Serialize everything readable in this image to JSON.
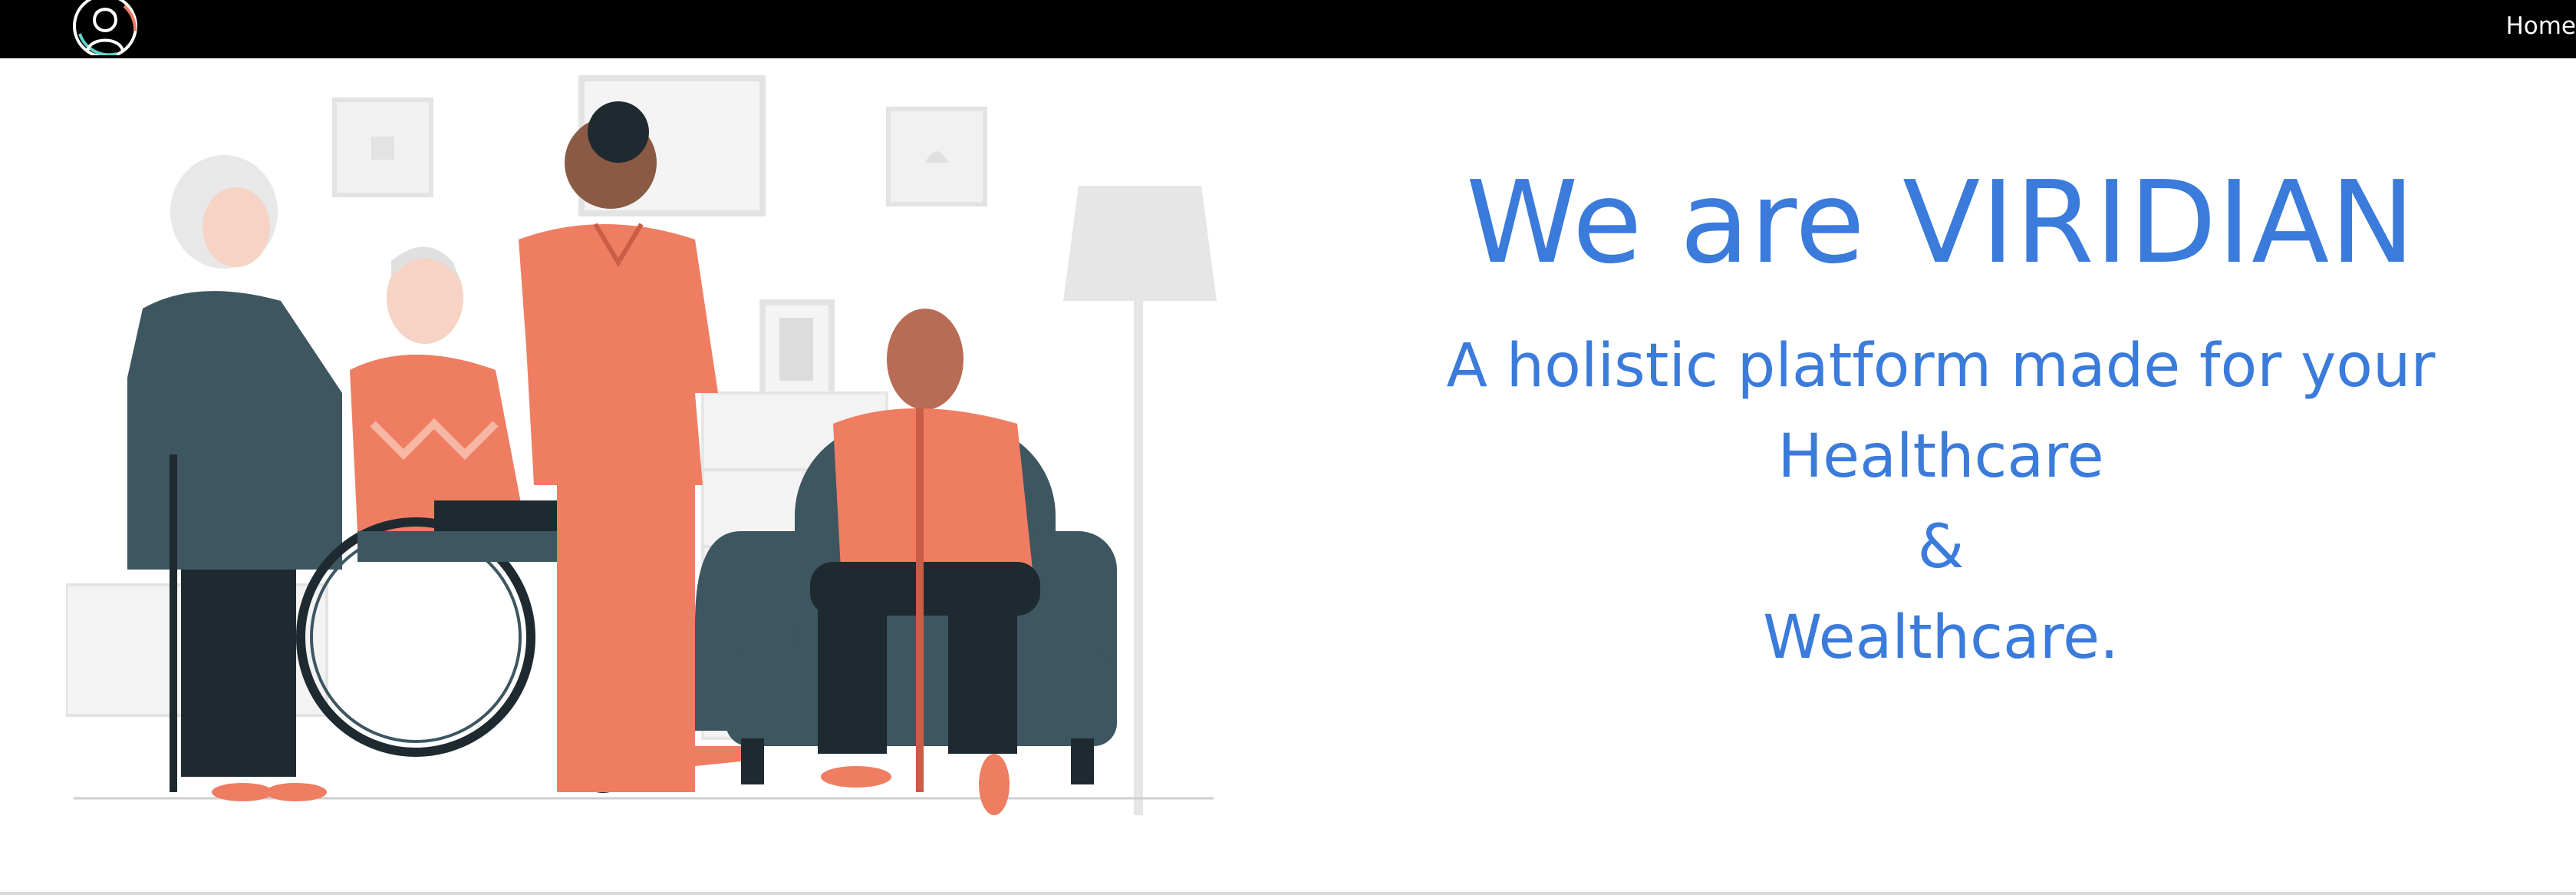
{
  "navbar": {
    "logo_icon": "person-avatar-logo-icon",
    "home_label": "Home",
    "background": "#000000"
  },
  "hero": {
    "illustration": "caregiver-with-elderly-people-illustration",
    "headline": "We are VIRIDIAN",
    "tagline_lines": [
      "A holistic platform made for your",
      "Healthcare",
      "&",
      "Wealthcare."
    ],
    "text_color": "#3a7bdb",
    "accent_color": "#ef7d62",
    "dark_color": "#3d5660"
  }
}
